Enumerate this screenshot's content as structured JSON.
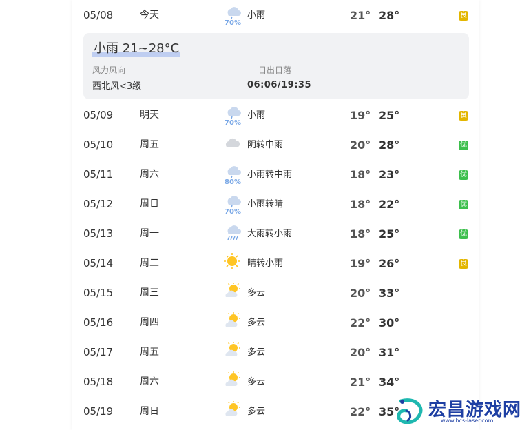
{
  "colors": {
    "aqi_good": "#e3b600",
    "aqi_excellent": "#3dbf4d",
    "precip_text": "#7aa8e6"
  },
  "rows": [
    {
      "date": "05/08",
      "day": "今天",
      "icon": "light-rain-icon",
      "precip": "70%",
      "cond": "小雨",
      "low": "21°",
      "high": "28°",
      "aqi": "良",
      "aqi_color": "#e3b600"
    },
    {
      "date": "05/09",
      "day": "明天",
      "icon": "light-rain-icon",
      "precip": "70%",
      "cond": "小雨",
      "low": "19°",
      "high": "25°",
      "aqi": "良",
      "aqi_color": "#e3b600"
    },
    {
      "date": "05/10",
      "day": "周五",
      "icon": "overcast-icon",
      "precip": "",
      "cond": "阴转中雨",
      "low": "20°",
      "high": "28°",
      "aqi": "优",
      "aqi_color": "#3dbf4d"
    },
    {
      "date": "05/11",
      "day": "周六",
      "icon": "light-rain-icon",
      "precip": "80%",
      "cond": "小雨转中雨",
      "low": "18°",
      "high": "23°",
      "aqi": "优",
      "aqi_color": "#3dbf4d"
    },
    {
      "date": "05/12",
      "day": "周日",
      "icon": "light-rain-icon",
      "precip": "70%",
      "cond": "小雨转晴",
      "low": "18°",
      "high": "22°",
      "aqi": "优",
      "aqi_color": "#3dbf4d"
    },
    {
      "date": "05/13",
      "day": "周一",
      "icon": "heavy-rain-icon",
      "precip": "",
      "cond": "大雨转小雨",
      "low": "18°",
      "high": "25°",
      "aqi": "优",
      "aqi_color": "#3dbf4d"
    },
    {
      "date": "05/14",
      "day": "周二",
      "icon": "sunny-icon",
      "precip": "",
      "cond": "晴转小雨",
      "low": "19°",
      "high": "26°",
      "aqi": "良",
      "aqi_color": "#e3b600"
    },
    {
      "date": "05/15",
      "day": "周三",
      "icon": "partly-cloudy-icon",
      "precip": "",
      "cond": "多云",
      "low": "20°",
      "high": "33°",
      "aqi": "",
      "aqi_color": ""
    },
    {
      "date": "05/16",
      "day": "周四",
      "icon": "partly-cloudy-icon",
      "precip": "",
      "cond": "多云",
      "low": "22°",
      "high": "30°",
      "aqi": "",
      "aqi_color": ""
    },
    {
      "date": "05/17",
      "day": "周五",
      "icon": "partly-cloudy-icon",
      "precip": "",
      "cond": "多云",
      "low": "20°",
      "high": "31°",
      "aqi": "",
      "aqi_color": ""
    },
    {
      "date": "05/18",
      "day": "周六",
      "icon": "partly-cloudy-icon",
      "precip": "",
      "cond": "多云",
      "low": "21°",
      "high": "34°",
      "aqi": "",
      "aqi_color": ""
    },
    {
      "date": "05/19",
      "day": "周日",
      "icon": "partly-cloudy-icon",
      "precip": "",
      "cond": "多云",
      "low": "22°",
      "high": "35°",
      "aqi": "",
      "aqi_color": ""
    }
  ],
  "detail": {
    "title": "小雨 21~28°C",
    "wind_label": "风力风向",
    "wind_value": "西北风<3级",
    "sun_label": "日出日落",
    "sun_value": "06:06/19:35"
  },
  "watermark": {
    "text": "宏昌游戏网",
    "url": "www.hcs-laser.com"
  }
}
